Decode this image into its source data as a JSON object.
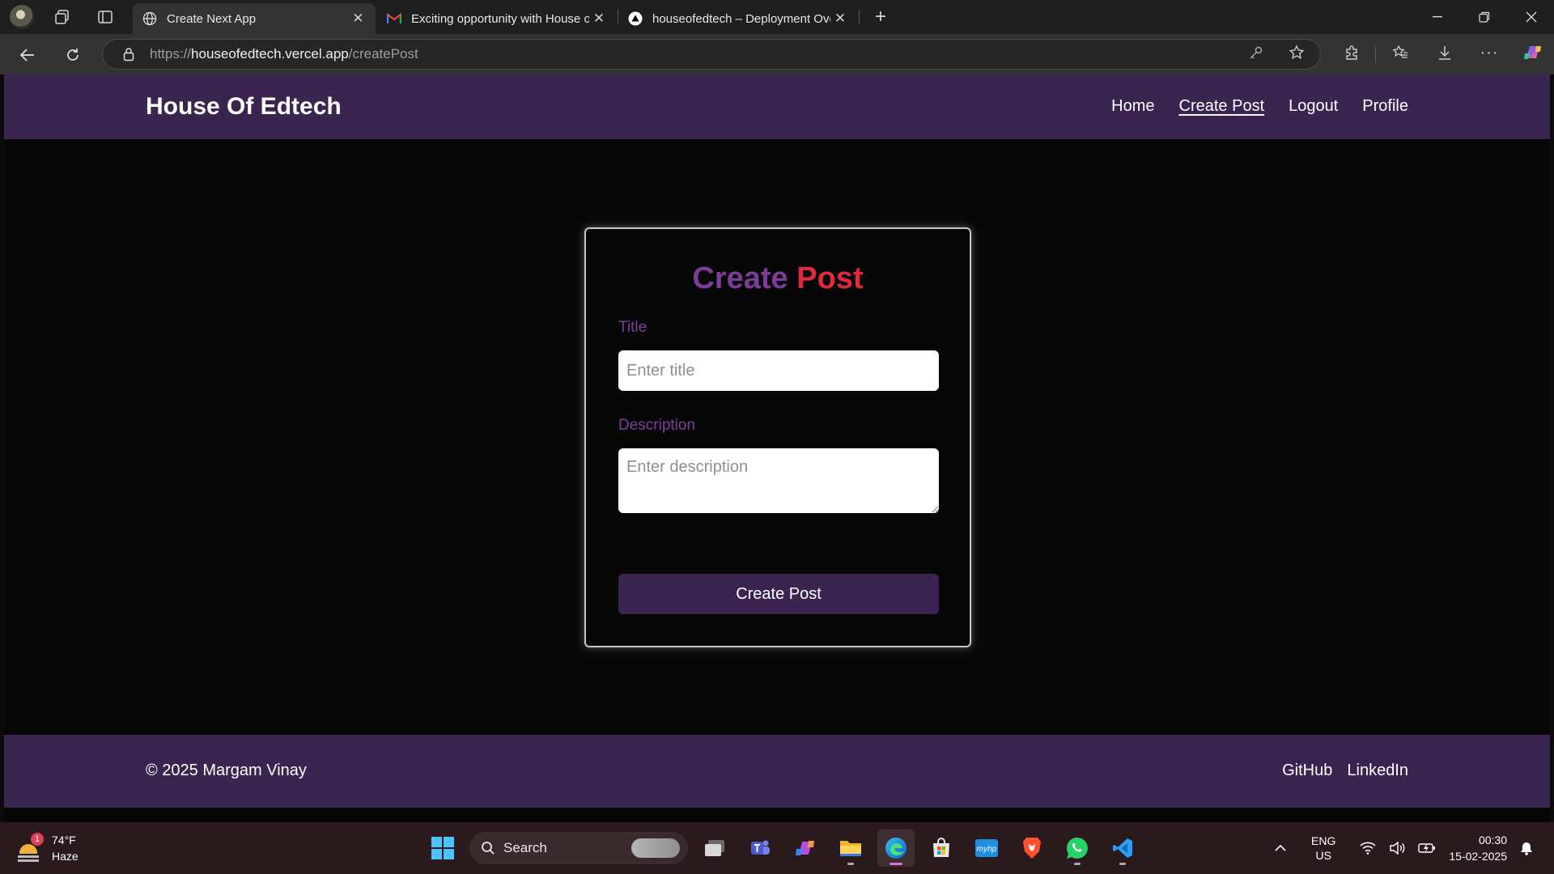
{
  "browser": {
    "tabs": [
      {
        "label": "Create Next App",
        "active": true,
        "favicon": "globe-icon"
      },
      {
        "label": "Exciting opportunity with House of",
        "active": false,
        "favicon": "gmail-icon"
      },
      {
        "label": "houseofedtech – Deployment Ove",
        "active": false,
        "favicon": "vercel-icon"
      }
    ],
    "url_scheme": "https://",
    "url_host": "houseofedtech.vercel.app",
    "url_path": "/createPost"
  },
  "site": {
    "brand": "House Of Edtech",
    "nav": [
      {
        "label": "Home",
        "current": false
      },
      {
        "label": "Create Post",
        "current": true
      },
      {
        "label": "Logout",
        "current": false
      },
      {
        "label": "Profile",
        "current": false
      }
    ]
  },
  "form": {
    "title_part1": "Create",
    "title_part2": "Post",
    "title_label": "Title",
    "title_placeholder": "Enter title",
    "description_label": "Description",
    "description_placeholder": "Enter description",
    "submit_label": "Create Post"
  },
  "footer": {
    "copyright": "© 2025 Margam Vinay",
    "links": [
      "GitHub",
      "LinkedIn"
    ]
  },
  "taskbar": {
    "weather_temp": "74°F",
    "weather_desc": "Haze",
    "weather_badge": "1",
    "search_label": "Search",
    "lang_line1": "ENG",
    "lang_line2": "US",
    "time": "00:30",
    "date": "15-02-2025"
  },
  "colors": {
    "header_bg": "#3a2450",
    "title_purple": "#7d3c98",
    "title_red": "#e0283e",
    "label_purple": "#7e3f9c"
  }
}
